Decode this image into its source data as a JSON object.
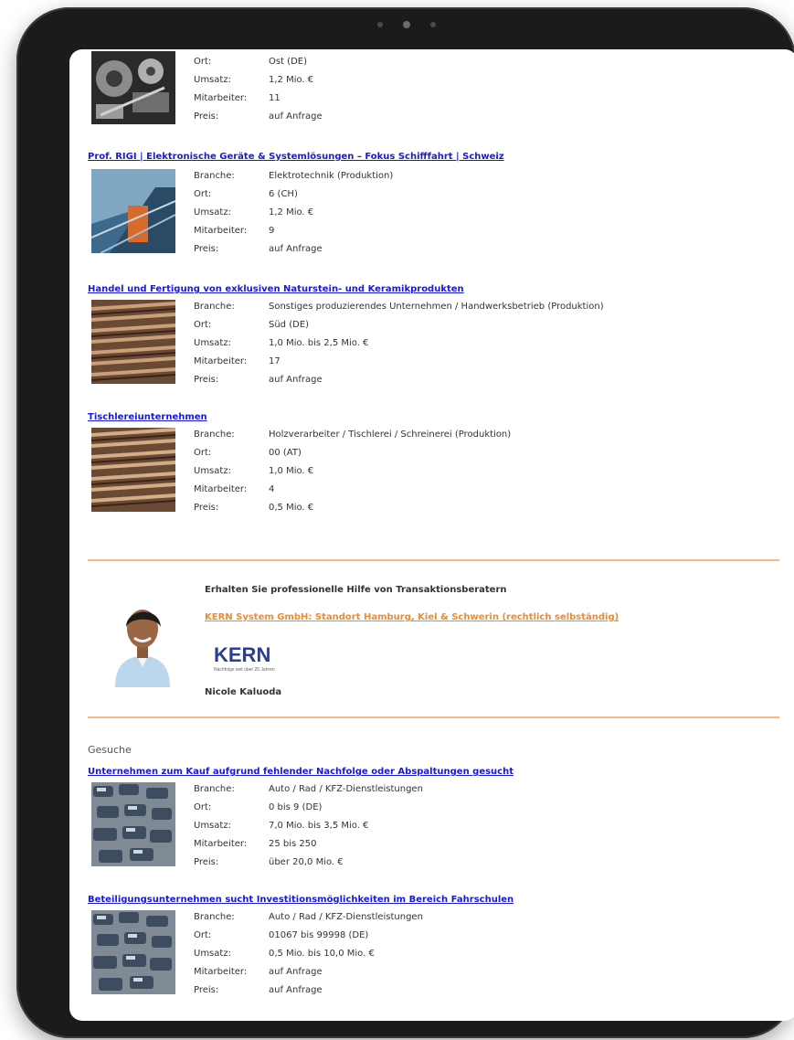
{
  "listings_top": [
    {
      "title": "",
      "rows": [
        {
          "key": "Ort:",
          "value": "Ost (DE)"
        },
        {
          "key": "Umsatz:",
          "value": "1,2 Mio. €"
        },
        {
          "key": "Mitarbeiter:",
          "value": "11"
        },
        {
          "key": "Preis:",
          "value": "auf Anfrage"
        }
      ]
    },
    {
      "title": "Prof. RIGI | Elektronische Geräte & Systemlösungen – Fokus Schifffahrt | Schweiz",
      "rows": [
        {
          "key": "Branche:",
          "value": "Elektrotechnik (Produktion)"
        },
        {
          "key": "Ort:",
          "value": "6 (CH)"
        },
        {
          "key": "Umsatz:",
          "value": "1,2 Mio. €"
        },
        {
          "key": "Mitarbeiter:",
          "value": "9"
        },
        {
          "key": "Preis:",
          "value": "auf Anfrage"
        }
      ]
    },
    {
      "title": "Handel und Fertigung von exklusiven Naturstein- und Keramikprodukten",
      "rows": [
        {
          "key": "Branche:",
          "value": "Sonstiges produzierendes Unternehmen / Handwerksbetrieb (Produktion)"
        },
        {
          "key": "Ort:",
          "value": "Süd (DE)"
        },
        {
          "key": "Umsatz:",
          "value": "1,0 Mio. bis 2,5 Mio. €"
        },
        {
          "key": "Mitarbeiter:",
          "value": "17"
        },
        {
          "key": "Preis:",
          "value": "auf Anfrage"
        }
      ]
    },
    {
      "title": "Tischlereiunternehmen",
      "rows": [
        {
          "key": "Branche:",
          "value": "Holzverarbeiter / Tischlerei / Schreinerei (Produktion)"
        },
        {
          "key": "Ort:",
          "value": "00 (AT)"
        },
        {
          "key": "Umsatz:",
          "value": "1,0 Mio. €"
        },
        {
          "key": "Mitarbeiter:",
          "value": "4"
        },
        {
          "key": "Preis:",
          "value": "0,5 Mio. €"
        }
      ]
    }
  ],
  "advisor": {
    "title": "Erhalten Sie professionelle Hilfe von Transaktionsberatern",
    "link": "KERN System GmbH: Standort Hamburg, Kiel & Schwerin (rechtlich selbständig)",
    "logo_text": "KERN",
    "logo_tagline": "Nachfolge seit über 25 Jahren",
    "name": "Nicole Kaluoda"
  },
  "gesuche": {
    "label": "Gesuche",
    "listings": [
      {
        "title": "Unternehmen zum Kauf aufgrund fehlender Nachfolge oder Abspaltungen gesucht",
        "rows": [
          {
            "key": "Branche:",
            "value": "Auto / Rad / KFZ-Dienstleistungen"
          },
          {
            "key": "Ort:",
            "value": "0 bis 9 (DE)"
          },
          {
            "key": "Umsatz:",
            "value": "7,0 Mio. bis 3,5 Mio. €"
          },
          {
            "key": "Mitarbeiter:",
            "value": "25 bis 250"
          },
          {
            "key": "Preis:",
            "value": "über 20,0 Mio. €"
          }
        ]
      },
      {
        "title": "Beteiligungsunternehmen sucht Investitionsmöglichkeiten im Bereich Fahrschulen",
        "rows": [
          {
            "key": "Branche:",
            "value": "Auto / Rad / KFZ-Dienstleistungen"
          },
          {
            "key": "Ort:",
            "value": "01067 bis 99998 (DE)"
          },
          {
            "key": "Umsatz:",
            "value": "0,5 Mio. bis 10,0 Mio. €"
          },
          {
            "key": "Mitarbeiter:",
            "value": "auf Anfrage"
          },
          {
            "key": "Preis:",
            "value": "auf Anfrage"
          }
        ]
      }
    ]
  },
  "colors": {
    "link": "#1a1ad6",
    "accent": "#f08a2a",
    "separator": "#f3b78a",
    "device": "#1b1b1b"
  }
}
